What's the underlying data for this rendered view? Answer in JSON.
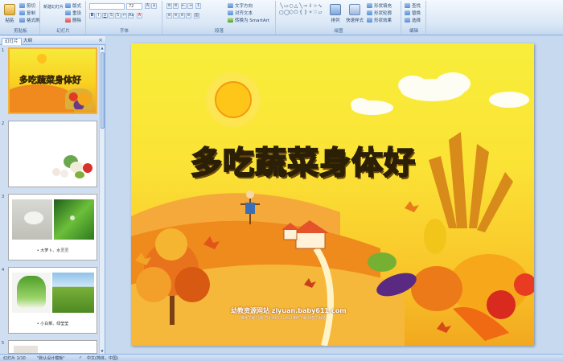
{
  "ribbon": {
    "clipboard": {
      "label": "剪贴板",
      "paste": "粘贴",
      "cut": "剪切",
      "copy": "复制",
      "format_painter": "格式刷"
    },
    "slides": {
      "label": "幻灯片",
      "new_slide": "新建幻灯片",
      "layout": "版式",
      "reset": "重设",
      "delete": "删除"
    },
    "font": {
      "label": "字体",
      "font_size": "72"
    },
    "paragraph": {
      "label": "段落",
      "text_direction": "文字方向",
      "align_text": "对齐文本",
      "convert_smartart": "转换为 SmartArt"
    },
    "drawing": {
      "label": "绘图",
      "arrange": "排列",
      "quick_styles": "快速样式",
      "shape_fill": "形状填充",
      "shape_outline": "形状轮廓",
      "shape_effects": "形状效果"
    },
    "editing": {
      "label": "编辑",
      "find": "查找",
      "replace": "替换",
      "select": "选择"
    }
  },
  "panel": {
    "tab_slides": "幻灯片",
    "tab_outline": "大纲",
    "close": "×",
    "thumbnails": [
      {
        "number": "1",
        "title": "多吃蔬菜身体好"
      },
      {
        "number": "2"
      },
      {
        "number": "3",
        "caption": "• 大萝卜、水灵灵"
      },
      {
        "number": "4",
        "caption": "• 小白菜、绿莹莹"
      },
      {
        "number": "5"
      }
    ]
  },
  "slide": {
    "title": "多吃蔬菜身体好",
    "watermark_main": "幼教资源网站 ziyuan.baby611.com",
    "watermark_sub": "课件下载   儿歌   音乐MP3   FLASH课件下载   试卷下载等"
  },
  "status": {
    "slide_counter": "幻灯片 1/10",
    "theme": "\"默认设计模板\"",
    "language": "中文(简体，中国)"
  },
  "colors": {
    "title_fill": "#ffe63a",
    "title_stroke": "#2b1f06",
    "selected_border": "#f0b43c",
    "ribbon_bg": "#dae7f6"
  }
}
